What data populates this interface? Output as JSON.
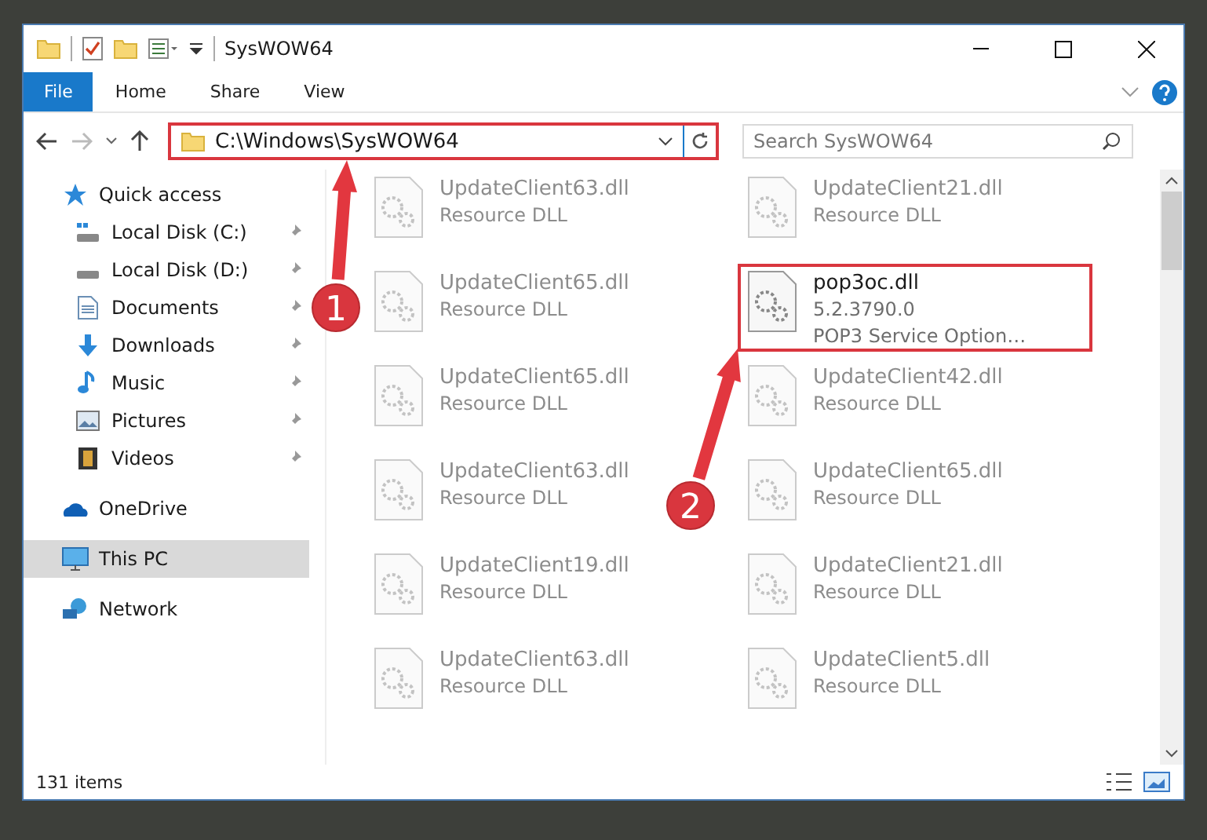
{
  "window": {
    "title": "SysWOW64"
  },
  "ribbon_tabs": [
    {
      "label": "File",
      "kind": "file"
    },
    {
      "label": "Home",
      "kind": "tab"
    },
    {
      "label": "Share",
      "kind": "tab"
    },
    {
      "label": "View",
      "kind": "tab"
    }
  ],
  "address_bar": {
    "path": "C:\\Windows\\SysWOW64",
    "highlighted": true
  },
  "search": {
    "placeholder": "Search SysWOW64"
  },
  "sidebar": {
    "items": [
      {
        "label": "Quick access",
        "selected": false,
        "children": [
          {
            "label": "Local Disk (C:)",
            "pinned": true
          },
          {
            "label": "Local Disk (D:)",
            "pinned": true
          },
          {
            "label": "Documents",
            "pinned": true
          },
          {
            "label": "Downloads",
            "pinned": true
          },
          {
            "label": "Music",
            "pinned": true
          },
          {
            "label": "Pictures",
            "pinned": true
          },
          {
            "label": "Videos",
            "pinned": true
          }
        ]
      },
      {
        "label": "OneDrive",
        "selected": false
      },
      {
        "label": "This PC",
        "selected": true
      },
      {
        "label": "Network",
        "selected": false
      }
    ]
  },
  "files": [
    {
      "lines": [
        "UpdateClient63.dll",
        "Resource DLL"
      ],
      "dimmed": true,
      "highlighted": false
    },
    {
      "lines": [
        "UpdateClient21.dll",
        "Resource DLL"
      ],
      "dimmed": true,
      "highlighted": false
    },
    {
      "lines": [
        "UpdateClient65.dll",
        "Resource DLL"
      ],
      "dimmed": true,
      "highlighted": false
    },
    {
      "lines": [
        "pop3oc.dll",
        "5.2.3790.0",
        "POP3 Service Option…"
      ],
      "dimmed": false,
      "highlighted": true
    },
    {
      "lines": [
        "UpdateClient65.dll",
        "Resource DLL"
      ],
      "dimmed": true,
      "highlighted": false
    },
    {
      "lines": [
        "UpdateClient42.dll",
        "Resource DLL"
      ],
      "dimmed": true,
      "highlighted": false
    },
    {
      "lines": [
        "UpdateClient63.dll",
        "Resource DLL"
      ],
      "dimmed": true,
      "highlighted": false
    },
    {
      "lines": [
        "UpdateClient65.dll",
        "Resource DLL"
      ],
      "dimmed": true,
      "highlighted": false
    },
    {
      "lines": [
        "UpdateClient19.dll",
        "Resource DLL"
      ],
      "dimmed": true,
      "highlighted": false
    },
    {
      "lines": [
        "UpdateClient21.dll",
        "Resource DLL"
      ],
      "dimmed": true,
      "highlighted": false
    },
    {
      "lines": [
        "UpdateClient63.dll",
        "Resource DLL"
      ],
      "dimmed": true,
      "highlighted": false
    },
    {
      "lines": [
        "UpdateClient5.dll",
        "Resource DLL"
      ],
      "dimmed": true,
      "highlighted": false
    }
  ],
  "status_bar": {
    "item_count": "131 items"
  },
  "annotations": [
    {
      "label": "1"
    },
    {
      "label": "2"
    }
  ]
}
